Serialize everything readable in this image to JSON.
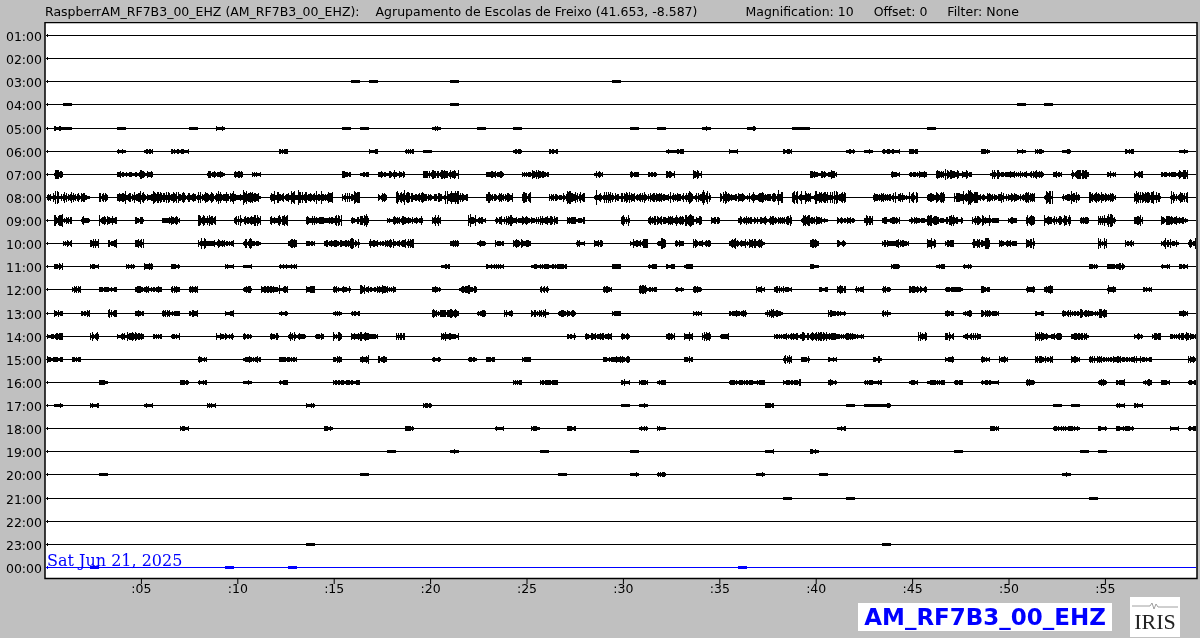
{
  "header": {
    "station": "RaspberrAM_RF7B3_00_EHZ (AM_RF7B3_00_EHZ):",
    "location": "Agrupamento de Escolas de Freixo (41.653, -8.587)",
    "magnification": "Magnification: 10",
    "offset": "Offset: 0",
    "filter": "Filter: None"
  },
  "rows": [
    {
      "label": "01:00",
      "color": "#000000"
    },
    {
      "label": "02:00",
      "color": "#000000"
    },
    {
      "label": "03:00",
      "color": "#000000"
    },
    {
      "label": "04:00",
      "color": "#000000"
    },
    {
      "label": "05:00",
      "color": "#000000"
    },
    {
      "label": "06:00",
      "color": "#000000"
    },
    {
      "label": "07:00",
      "color": "#000000"
    },
    {
      "label": "08:00",
      "color": "#000000"
    },
    {
      "label": "09:00",
      "color": "#000000"
    },
    {
      "label": "10:00",
      "color": "#000000"
    },
    {
      "label": "11:00",
      "color": "#000000"
    },
    {
      "label": "12:00",
      "color": "#000000"
    },
    {
      "label": "13:00",
      "color": "#000000"
    },
    {
      "label": "14:00",
      "color": "#000000"
    },
    {
      "label": "15:00",
      "color": "#000000"
    },
    {
      "label": "16:00",
      "color": "#000000"
    },
    {
      "label": "17:00",
      "color": "#000000"
    },
    {
      "label": "18:00",
      "color": "#000000"
    },
    {
      "label": "19:00",
      "color": "#000000"
    },
    {
      "label": "20:00",
      "color": "#000000"
    },
    {
      "label": "21:00",
      "color": "#000000"
    },
    {
      "label": "22:00",
      "color": "#000000"
    },
    {
      "label": "23:00",
      "color": "#000000"
    },
    {
      "label": "00:00",
      "color": "#0000ff"
    }
  ],
  "date": "Sat Jun 21, 2025",
  "ticks": [
    ":05",
    ":10",
    ":15",
    ":20",
    ":25",
    ":30",
    ":35",
    ":40",
    ":45",
    ":50",
    ":55"
  ],
  "channel": "AM_RF7B3_00_EHZ",
  "logo": "IRIS"
}
